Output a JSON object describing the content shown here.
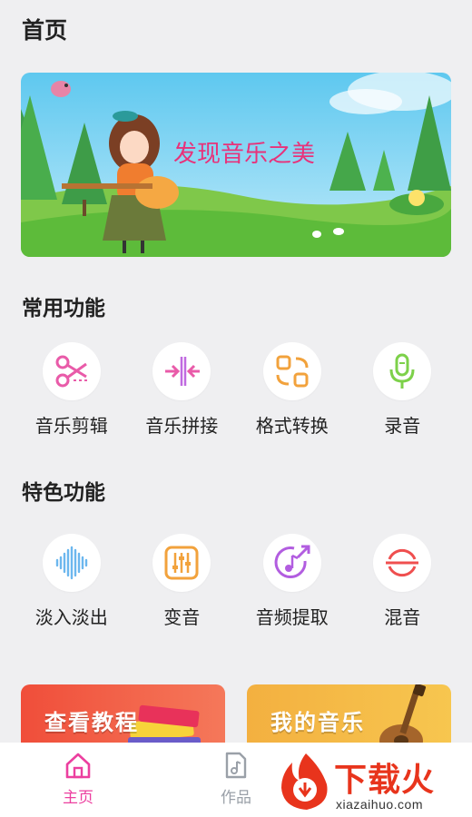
{
  "header": {
    "title": "首页"
  },
  "banner": {
    "slogan": "发现音乐之美"
  },
  "common": {
    "title": "常用功能",
    "items": [
      {
        "label": "音乐剪辑",
        "icon": "scissors-icon"
      },
      {
        "label": "音乐拼接",
        "icon": "merge-icon"
      },
      {
        "label": "格式转换",
        "icon": "convert-icon"
      },
      {
        "label": "录音",
        "icon": "microphone-icon"
      }
    ]
  },
  "featured": {
    "title": "特色功能",
    "items": [
      {
        "label": "淡入淡出",
        "icon": "waveform-icon"
      },
      {
        "label": "变音",
        "icon": "equalizer-icon"
      },
      {
        "label": "音频提取",
        "icon": "extract-music-icon"
      },
      {
        "label": "混音",
        "icon": "mix-icon"
      }
    ]
  },
  "cards": [
    {
      "label": "查看教程",
      "color": "#f05a3c"
    },
    {
      "label": "我的音乐",
      "color": "#f6a829"
    }
  ],
  "nav": {
    "items": [
      {
        "label": "主页",
        "icon": "home-icon",
        "active": true
      },
      {
        "label": "作品",
        "icon": "music-file-icon",
        "active": false
      }
    ]
  },
  "watermark": {
    "text": "下载火",
    "sub": "xiazaihuo.com"
  },
  "colors": {
    "accent": "#ec3f9f",
    "inactive": "#9aa0a8"
  }
}
